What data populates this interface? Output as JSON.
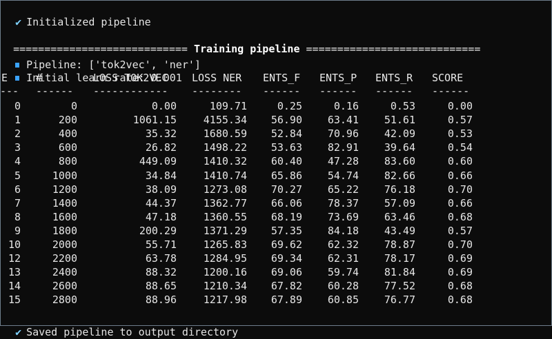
{
  "terminal": {
    "init_icon": "checkmark-icon",
    "init_text": "Initialized pipeline",
    "header_left_rule": "============================",
    "header_title": "Training pipeline",
    "header_right_rule": "============================",
    "bullet_icon": "info-bullet-icon",
    "pipeline_text": "Pipeline: ['tok2vec', 'ner']",
    "learn_rate_text": "Initial learn rate: 0.001",
    "saved_icon": "checkmark-icon",
    "saved_text": "Saved pipeline to output directory"
  },
  "table": {
    "columns": [
      "E",
      "#",
      "LOSS TOK2VEC",
      "LOSS NER",
      "ENTS_F",
      "ENTS_P",
      "ENTS_R",
      "SCORE"
    ],
    "dashes": [
      "---",
      "------",
      "------------",
      "--------",
      "------",
      "------",
      "------",
      "------"
    ],
    "rows": [
      [
        "0",
        "0",
        "0.00",
        "109.71",
        "0.25",
        "0.16",
        "0.53",
        "0.00"
      ],
      [
        "1",
        "200",
        "1061.15",
        "4155.34",
        "56.90",
        "63.41",
        "51.61",
        "0.57"
      ],
      [
        "2",
        "400",
        "35.32",
        "1680.59",
        "52.84",
        "70.96",
        "42.09",
        "0.53"
      ],
      [
        "3",
        "600",
        "26.82",
        "1498.22",
        "53.63",
        "82.91",
        "39.64",
        "0.54"
      ],
      [
        "4",
        "800",
        "449.09",
        "1410.32",
        "60.40",
        "47.28",
        "83.60",
        "0.60"
      ],
      [
        "5",
        "1000",
        "34.84",
        "1410.74",
        "65.86",
        "54.74",
        "82.66",
        "0.66"
      ],
      [
        "6",
        "1200",
        "38.09",
        "1273.08",
        "70.27",
        "65.22",
        "76.18",
        "0.70"
      ],
      [
        "7",
        "1400",
        "44.37",
        "1362.77",
        "66.06",
        "78.37",
        "57.09",
        "0.66"
      ],
      [
        "8",
        "1600",
        "47.18",
        "1360.55",
        "68.19",
        "73.69",
        "63.46",
        "0.68"
      ],
      [
        "9",
        "1800",
        "200.29",
        "1371.29",
        "57.35",
        "84.18",
        "43.49",
        "0.57"
      ],
      [
        "10",
        "2000",
        "55.71",
        "1265.83",
        "69.62",
        "62.32",
        "78.87",
        "0.70"
      ],
      [
        "12",
        "2200",
        "63.78",
        "1284.95",
        "69.34",
        "62.31",
        "78.17",
        "0.69"
      ],
      [
        "13",
        "2400",
        "88.32",
        "1200.16",
        "69.06",
        "59.74",
        "81.84",
        "0.69"
      ],
      [
        "14",
        "2600",
        "88.65",
        "1210.34",
        "67.82",
        "60.28",
        "77.52",
        "0.68"
      ],
      [
        "15",
        "2800",
        "88.96",
        "1217.98",
        "67.89",
        "60.85",
        "76.77",
        "0.68"
      ]
    ]
  }
}
